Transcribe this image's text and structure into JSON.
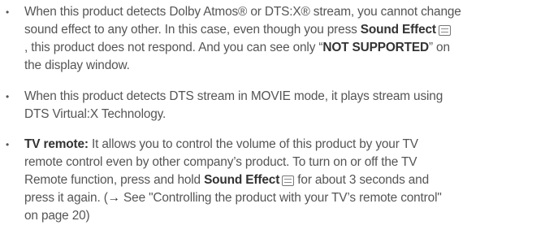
{
  "bullets": [
    {
      "lines": {
        "l1": "When this product detects Dolby Atmos® or DTS:X® stream, you cannot change",
        "l2a": "sound effect to any other. In this case, even though you press ",
        "l2b": "Sound Effect",
        "l3": ", this product does not respond. And you can see only “",
        "l3b": "NOT SUPPORTED",
        "l3c": "” on",
        "l4": "the display window."
      }
    },
    {
      "lines": {
        "l1": "When this product detects DTS stream in MOVIE mode, it plays stream using",
        "l2": "DTS Virtual:X Technology."
      }
    },
    {
      "lines": {
        "l1a": "TV remote:",
        "l1b": " It allows you to control the volume of this product by your TV",
        "l2": "remote control even by other company’s product. To turn on or off the TV",
        "l3a": "Remote function, press and hold ",
        "l3b": "Sound Effect",
        "l3c": " for about 3 seconds and",
        "l4a": "press it again. (",
        "l4arrow": "→",
        "l4b": " See \"Controlling the product with your TV’s remote control\"",
        "l5": "on page 20)"
      }
    }
  ],
  "bullet_symbol": "•",
  "icons": {
    "sound_effect_button": "sound-effect-button-icon"
  }
}
